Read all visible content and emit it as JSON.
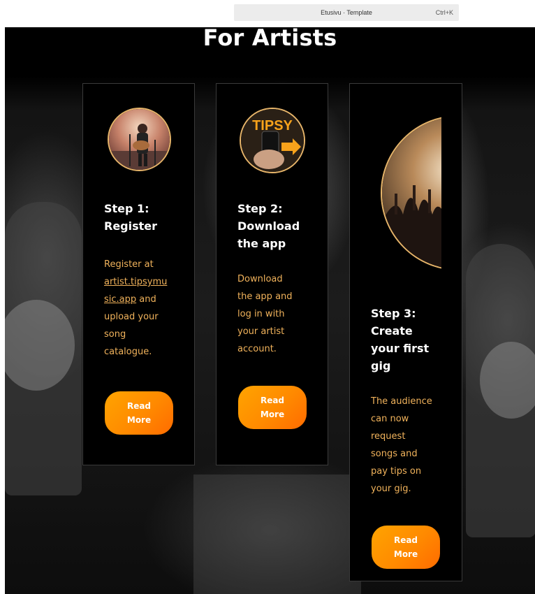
{
  "search": {
    "title": "Etusivu · Template",
    "shortcut": "Ctrl+K"
  },
  "heading": "For Artists",
  "steps": [
    {
      "title_line1": "Step 1:",
      "title_line2": "Register",
      "desc_line1": "Register at",
      "link_line1": "artist.tipsymu",
      "link_line2": "sic.app",
      "desc_after_link": " and",
      "desc_line4": "upload your",
      "desc_line5": "song",
      "desc_line6": "catalogue.",
      "button_line1": "Read",
      "button_line2": "More",
      "image": "performer-with-guitar"
    },
    {
      "title_line1": "Step 2:",
      "title_line2": "Download",
      "title_line3": "the app",
      "desc_line1": "Download",
      "desc_line2": "the app and",
      "desc_line3": "log in with",
      "desc_line4": "your artist",
      "desc_line5": "account.",
      "logo_text": "TIPSY",
      "button_line1": "Read",
      "button_line2": "More",
      "image": "phone-with-tipsy-app"
    },
    {
      "title_line1": "Step 3:",
      "title_line2": "Create",
      "title_line3": "your first",
      "title_line4": "gig",
      "desc_line1": "The audience",
      "desc_line2": "can now",
      "desc_line3": "request",
      "desc_line4": "songs and",
      "desc_line5": "pay tips on",
      "desc_line6": "your gig.",
      "button_line1": "Read",
      "button_line2": "More",
      "image": "concert-crowd"
    }
  ],
  "colors": {
    "accent_text": "#f0b25b",
    "button_start": "#ffa400",
    "button_end": "#ff6b00",
    "avatar_ring": "#e7b56a",
    "card_bg": "#000000"
  }
}
